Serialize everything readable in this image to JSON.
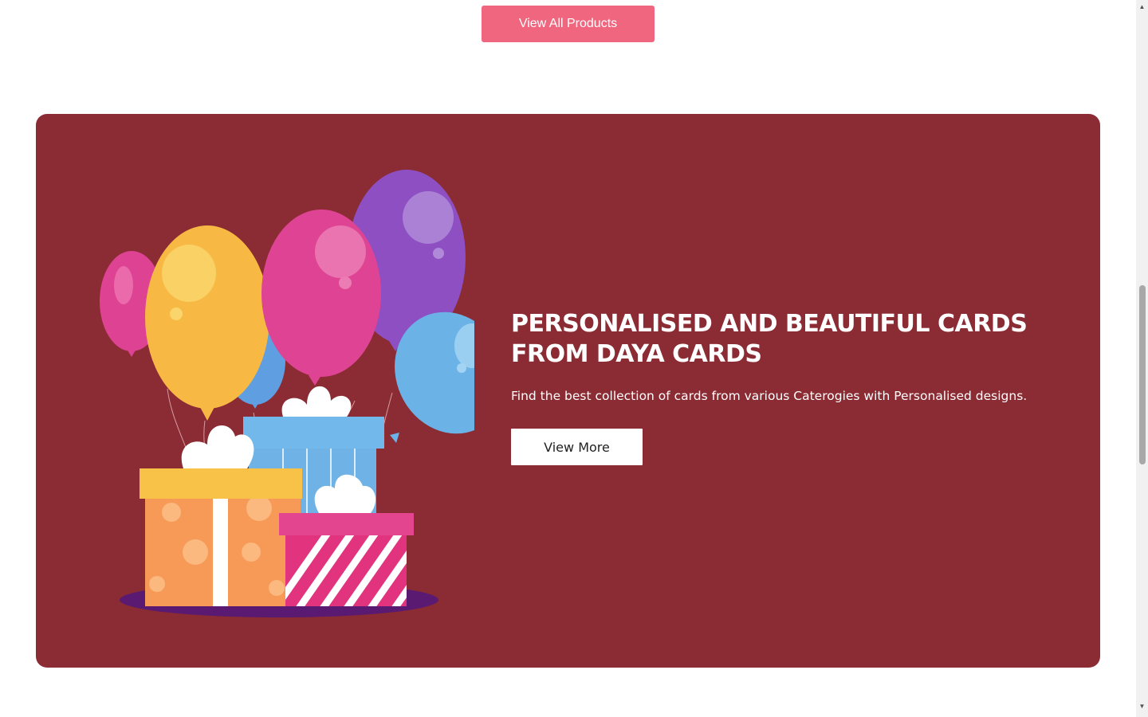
{
  "top_button": {
    "label": "View All Products"
  },
  "banner": {
    "headline_line1": "PERSONALISED AND BEAUTIFUL CARDS",
    "headline_line2": "FROM DAYA CARDS",
    "subtext": "Find the best collection of cards from various Caterogies with Personalised designs.",
    "button_label": "View More"
  },
  "colors": {
    "accent": "#f0667f",
    "banner_background": "#8b2b33",
    "button_background": "#ffffff"
  },
  "icons": {
    "scroll_up": "scroll-up-arrow-icon",
    "scroll_down": "scroll-down-arrow-icon",
    "illustration": "balloons-gifts-illustration"
  }
}
